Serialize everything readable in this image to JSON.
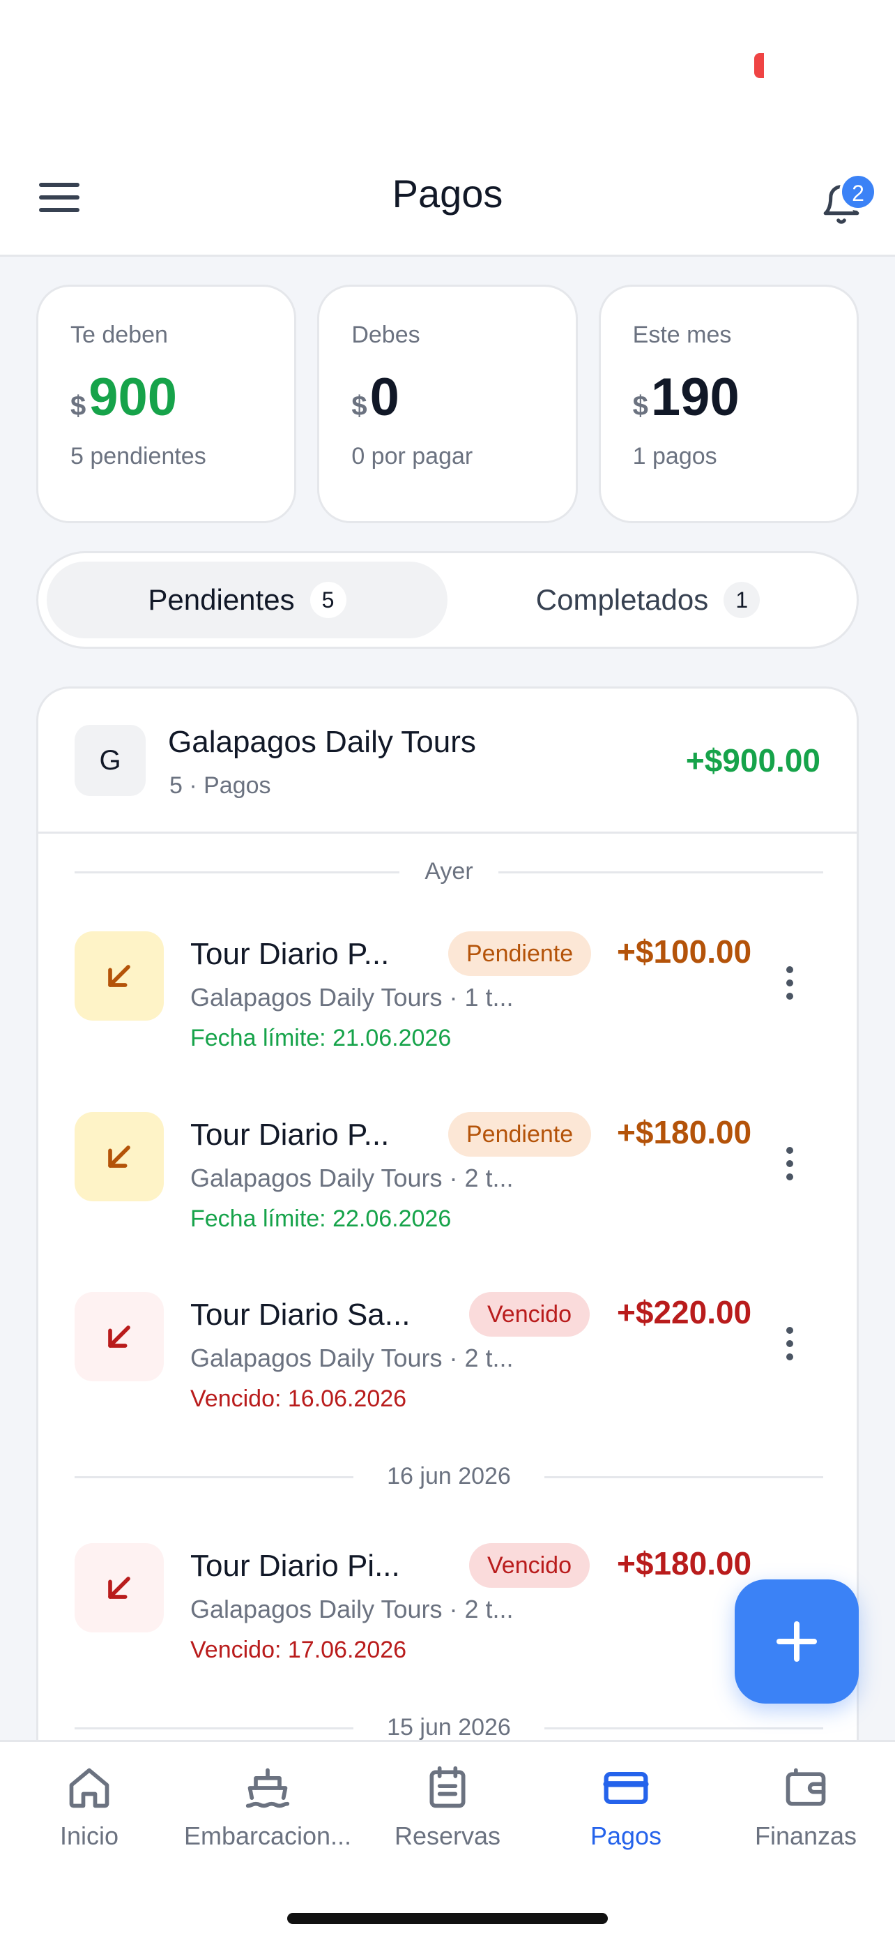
{
  "header": {
    "title": "Pagos",
    "notifications_count": "2"
  },
  "summary": [
    {
      "label": "Te deben",
      "currency": "$",
      "amount": "900",
      "sub": "5 pendientes",
      "accent": "#16a34a"
    },
    {
      "label": "Debes",
      "currency": "$",
      "amount": "0",
      "sub": "0 por pagar"
    },
    {
      "label": "Este mes",
      "currency": "$",
      "amount": "190",
      "sub": "1 pagos"
    }
  ],
  "tabs": [
    {
      "label": "Pendientes",
      "count": "5",
      "active": true
    },
    {
      "label": "Completados",
      "count": "1",
      "active": false
    }
  ],
  "group": {
    "avatar": "G",
    "name": "Galapagos Daily Tours",
    "sub": "5 · Pagos",
    "total": "+$900.00"
  },
  "sections": [
    {
      "date": "Ayer"
    },
    {
      "date": "16 jun 2026"
    },
    {
      "date": "15 jun 2026"
    }
  ],
  "payments": [
    {
      "title": "Tour Diario P...",
      "status": "Pendiente",
      "amount": "+$100.00",
      "sub": "Galapagos Daily Tours · 1 t...",
      "due": "Fecha límite: 21.06.2026",
      "tone": "pending"
    },
    {
      "title": "Tour Diario P...",
      "status": "Pendiente",
      "amount": "+$180.00",
      "sub": "Galapagos Daily Tours · 2 t...",
      "due": "Fecha límite: 22.06.2026",
      "tone": "pending"
    },
    {
      "title": "Tour Diario Sa...",
      "status": "Vencido",
      "amount": "+$220.00",
      "sub": "Galapagos Daily Tours · 2 t...",
      "due": "Vencido: 16.06.2026",
      "tone": "overdue"
    },
    {
      "title": "Tour Diario Pi...",
      "status": "Vencido",
      "amount": "+$180.00",
      "sub": "Galapagos Daily Tours · 2 t...",
      "due": "Vencido: 17.06.2026",
      "tone": "overdue"
    }
  ],
  "nav": [
    {
      "label": "Inicio",
      "icon": "home-icon"
    },
    {
      "label": "Embarcacion...",
      "icon": "boat-icon"
    },
    {
      "label": "Reservas",
      "icon": "calendar-icon"
    },
    {
      "label": "Pagos",
      "icon": "card-icon",
      "active": true
    },
    {
      "label": "Finanzas",
      "icon": "wallet-icon"
    }
  ],
  "colors": {
    "accent": "#3b82f6",
    "positive": "#16a34a",
    "pending": "#b45309",
    "overdue": "#b91c1c"
  }
}
